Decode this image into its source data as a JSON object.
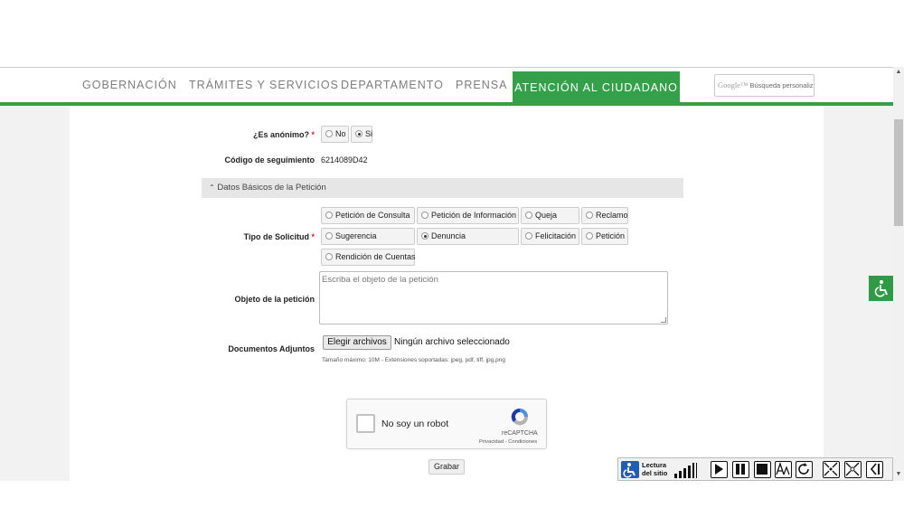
{
  "nav": {
    "items": [
      "GOBERNACIÓN",
      "TRÁMITES Y SERVICIOS",
      "DEPARTAMENTO",
      "PRENSA"
    ],
    "active": "ATENCIÓN AL CIUDADANO",
    "search_brand": "Google™",
    "search_placeholder": "Búsqueda personaliz"
  },
  "form": {
    "anonimo": {
      "label": "¿Es anónimo?",
      "required": "*",
      "options": [
        "No",
        "Si"
      ],
      "selected": "Si"
    },
    "codigo": {
      "label": "Código de seguimiento",
      "value": "6214089D42"
    },
    "section_title": "Datos Básicos de la Petición",
    "section_icon": "chevron-up-icon",
    "tipo": {
      "label": "Tipo de Solicitud",
      "required": "*",
      "options": [
        "Petición de Consulta",
        "Petición de Información",
        "Queja",
        "Reclamo",
        "Sugerencia",
        "Denuncia",
        "Felicitación",
        "Petición",
        "Rendición de Cuentas"
      ],
      "selected": "Denuncia"
    },
    "objeto": {
      "label": "Objeto de la petición",
      "placeholder": "Escriba el objeto de la petición"
    },
    "documentos": {
      "label": "Documentos Adjuntos",
      "button": "Elegir archivos",
      "status": "Ningún archivo seleccionado",
      "hint": "Tamaño máximo: 10M - Extensiones soportadas: jpeg, pdf, tiff, jpg,png"
    },
    "captcha": {
      "text": "No soy un robot",
      "brand": "reCAPTCHA",
      "links": "Privacidad - Condiciones"
    },
    "submit": "Grabar"
  },
  "reader": {
    "line1": "Lectura",
    "line2": "del sitio",
    "icons": [
      "volume-icon",
      "play-icon",
      "pause-icon",
      "stop-icon",
      "font-size-icon",
      "repeat-icon",
      "expand-icon",
      "collapse-icon",
      "back-icon"
    ]
  },
  "colors": {
    "brand_green": "#35a04a",
    "required_red": "#d9262b"
  }
}
